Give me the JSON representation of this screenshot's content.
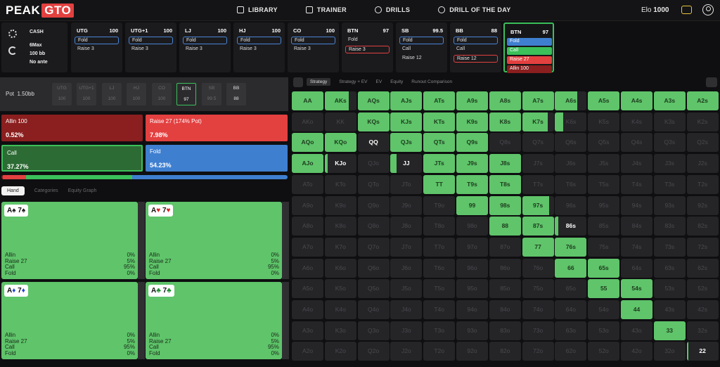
{
  "app": {
    "logo_left": "PEAK",
    "logo_right": "GTO"
  },
  "nav": [
    {
      "label": "LIBRARY",
      "icon": "book-icon"
    },
    {
      "label": "TRAINER",
      "icon": "gamepad-icon"
    },
    {
      "label": "DRILLS",
      "icon": "target-icon"
    },
    {
      "label": "DRILL OF THE DAY",
      "icon": "plus-circle-icon"
    }
  ],
  "elo": {
    "label": "Elo",
    "value": "1000"
  },
  "settings": {
    "game": "CASH",
    "format": "6Max",
    "stack": "100 bb",
    "ante": "No ante"
  },
  "seats": [
    {
      "name": "UTG",
      "stack": "100",
      "actions": [
        {
          "t": "Fold",
          "s": "fold"
        },
        {
          "t": "Raise 3",
          "s": "plain"
        }
      ]
    },
    {
      "name": "UTG+1",
      "stack": "100",
      "actions": [
        {
          "t": "Fold",
          "s": "fold"
        },
        {
          "t": "Raise 3",
          "s": "plain"
        }
      ]
    },
    {
      "name": "LJ",
      "stack": "100",
      "actions": [
        {
          "t": "Fold",
          "s": "fold"
        },
        {
          "t": "Raise 3",
          "s": "plain"
        }
      ]
    },
    {
      "name": "HJ",
      "stack": "100",
      "actions": [
        {
          "t": "Fold",
          "s": "fold"
        },
        {
          "t": "Raise 3",
          "s": "plain"
        }
      ]
    },
    {
      "name": "CO",
      "stack": "100",
      "actions": [
        {
          "t": "Fold",
          "s": "fold"
        },
        {
          "t": "Raise 3",
          "s": "plain"
        }
      ]
    },
    {
      "name": "BTN",
      "stack": "97",
      "actions": [
        {
          "t": "Fold",
          "s": "plain"
        },
        {
          "t": "Raise 3",
          "s": "red"
        }
      ]
    },
    {
      "name": "SB",
      "stack": "99.5",
      "actions": [
        {
          "t": "Fold",
          "s": "fold"
        },
        {
          "t": "Call",
          "s": "plain"
        },
        {
          "t": "Raise 12",
          "s": "plain"
        }
      ]
    },
    {
      "name": "BB",
      "stack": "88",
      "actions": [
        {
          "t": "Fold",
          "s": "fold"
        },
        {
          "t": "Call",
          "s": "plain"
        },
        {
          "t": "Raise 12",
          "s": "red"
        }
      ]
    },
    {
      "name": "BTN",
      "stack": "97",
      "active": true,
      "actions": [
        {
          "t": "Fold",
          "s": "blue"
        },
        {
          "t": "Call",
          "s": "green"
        },
        {
          "t": "Raise 27",
          "s": "redfill"
        },
        {
          "t": "Allin 100",
          "s": "darkred"
        }
      ]
    }
  ],
  "pot": {
    "label": "Pot",
    "value": "1.50bb"
  },
  "pot_chips": [
    {
      "pos": "UTG",
      "stack": "100"
    },
    {
      "pos": "UTG+1",
      "stack": "100"
    },
    {
      "pos": "LJ",
      "stack": "100"
    },
    {
      "pos": "HJ",
      "stack": "100"
    },
    {
      "pos": "CO",
      "stack": "100"
    },
    {
      "pos": "BTN",
      "stack": "97"
    },
    {
      "pos": "SB",
      "stack": "99.5"
    },
    {
      "pos": "BB",
      "stack": "88"
    }
  ],
  "actions": {
    "allin": {
      "label": "Allin 100",
      "pct": "0.52%"
    },
    "raise": {
      "label": "Raise 27 (174% Pot)",
      "pct": "7.98%"
    },
    "call": {
      "label": "Call",
      "pct": "37.27%"
    },
    "fold": {
      "label": "Fold",
      "pct": "54.23%"
    }
  },
  "action_bar": [
    {
      "frac": 0.005,
      "color": "#8b1e1e"
    },
    {
      "frac": 0.08,
      "color": "#e34040"
    },
    {
      "frac": 0.373,
      "color": "#3bc05a"
    },
    {
      "frac": 0.542,
      "color": "#3f7fd0"
    }
  ],
  "tabs": [
    "Hand",
    "Categories",
    "Equity Graph"
  ],
  "combos": [
    {
      "rank1": "A",
      "suit1": "♠",
      "rank2": "7",
      "suit2": "♠",
      "color": "k"
    },
    {
      "rank1": "A",
      "suit1": "♥",
      "rank2": "7",
      "suit2": "♥",
      "color": "r"
    },
    {
      "rank1": "A",
      "suit1": "♦",
      "rank2": "7",
      "suit2": "♦",
      "color": "bl"
    },
    {
      "rank1": "A",
      "suit1": "♣",
      "rank2": "7",
      "suit2": "♣",
      "color": "g"
    }
  ],
  "combo_freqs": [
    {
      "label": "Allin",
      "value": "0%"
    },
    {
      "label": "Raise 27",
      "value": "5%"
    },
    {
      "label": "Call",
      "value": "95%"
    },
    {
      "label": "Fold",
      "value": "0%"
    }
  ],
  "grid_tabs": [
    "Strategy",
    "Strategy + EV",
    "EV",
    "Equity",
    "Runout Comparison"
  ],
  "ranks": [
    "A",
    "K",
    "Q",
    "J",
    "T",
    "9",
    "8",
    "7",
    "6",
    "5",
    "4",
    "3",
    "2"
  ],
  "range_fill": [
    [
      1.0,
      0.75,
      1.0,
      1.0,
      1.0,
      1.0,
      1.0,
      1.0,
      0.7,
      1.0,
      1.0,
      1.0,
      1.0
    ],
    [
      0.0,
      0.0,
      1.0,
      1.0,
      1.0,
      1.0,
      1.0,
      0.8,
      0.25,
      0.0,
      0.0,
      0.0,
      0.0
    ],
    [
      1.0,
      1.0,
      0.0,
      1.0,
      1.0,
      1.0,
      0.0,
      0.0,
      0.0,
      0.0,
      0.0,
      0.0,
      0.0
    ],
    [
      1.0,
      0.1,
      0.0,
      0.2,
      1.0,
      1.0,
      1.0,
      0.0,
      0.0,
      0.0,
      0.0,
      0.0,
      0.0
    ],
    [
      0.0,
      0.0,
      0.0,
      0.0,
      1.0,
      1.0,
      1.0,
      0.0,
      0.0,
      0.0,
      0.0,
      0.0,
      0.0
    ],
    [
      0.0,
      0.0,
      0.0,
      0.0,
      0.0,
      1.0,
      1.0,
      0.85,
      0.0,
      0.0,
      0.0,
      0.0,
      0.0
    ],
    [
      0.0,
      0.0,
      0.0,
      0.0,
      0.0,
      0.0,
      1.0,
      1.0,
      0.1,
      0.0,
      0.0,
      0.0,
      0.0
    ],
    [
      0.0,
      0.0,
      0.0,
      0.0,
      0.0,
      0.0,
      0.0,
      1.0,
      1.0,
      0.0,
      0.0,
      0.0,
      0.0
    ],
    [
      0.0,
      0.0,
      0.0,
      0.0,
      0.0,
      0.0,
      0.0,
      0.0,
      1.0,
      1.0,
      0.0,
      0.0,
      0.0
    ],
    [
      0.0,
      0.0,
      0.0,
      0.0,
      0.0,
      0.0,
      0.0,
      0.0,
      0.0,
      1.0,
      1.0,
      0.0,
      0.0
    ],
    [
      0.0,
      0.0,
      0.0,
      0.0,
      0.0,
      0.0,
      0.0,
      0.0,
      0.0,
      0.0,
      1.0,
      0.0,
      0.0
    ],
    [
      0.0,
      0.0,
      0.0,
      0.0,
      0.0,
      0.0,
      0.0,
      0.0,
      0.0,
      0.0,
      0.0,
      1.0,
      0.0
    ],
    [
      0.0,
      0.0,
      0.0,
      0.0,
      0.0,
      0.0,
      0.0,
      0.0,
      0.0,
      0.0,
      0.0,
      0.0,
      0.05
    ]
  ],
  "range_white": [
    "QQ",
    "KJo",
    "JJ",
    "86s",
    "22"
  ],
  "colors": {
    "green": "#5fc46a",
    "red": "#e34040",
    "blue": "#3f7fd0",
    "darkred": "#8b1e1e",
    "call_green": "#3bc05a"
  }
}
